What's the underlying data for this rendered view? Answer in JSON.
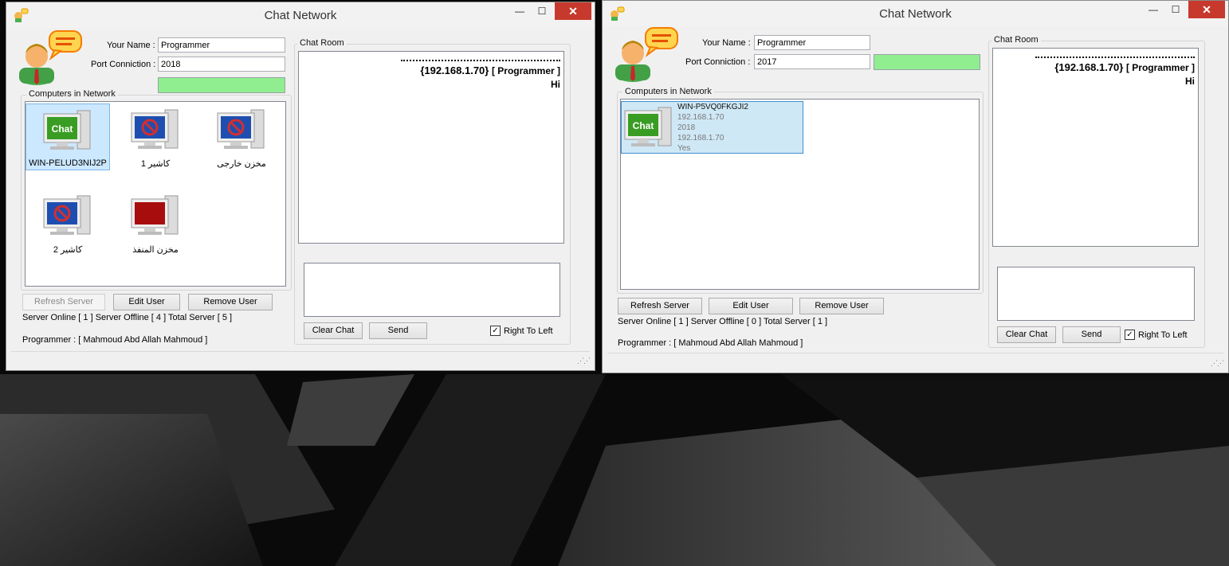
{
  "left_window": {
    "title": "Chat Network",
    "your_name_label": "Your Name :",
    "your_name_value": "Programmer",
    "port_label": "Port Conniction :",
    "port_value": "2018",
    "status_color": "#90ee90",
    "computers_label": "Computers in Network",
    "computers": [
      {
        "name": "WIN-PELUD3NIJ2P",
        "icon": "chat-monitor-icon",
        "selected": true
      },
      {
        "name": "كاشير 1",
        "icon": "blocked-monitor-icon",
        "selected": false
      },
      {
        "name": "مخزن خارجى",
        "icon": "blocked-monitor-icon",
        "selected": false
      },
      {
        "name": "كاشير 2",
        "icon": "blocked-monitor-icon",
        "selected": false
      },
      {
        "name": "مخزن المنفذ",
        "icon": "red-monitor-icon",
        "selected": false
      }
    ],
    "refresh_label": "Refresh Server",
    "edit_label": "Edit User",
    "remove_label": "Remove User",
    "server_status": "Server Online [ 1 ]  Server Offline [ 4 ] Total Server [ 5 ]",
    "programmer": "Programmer : [ Mahmoud Abd Allah Mahmoud ]",
    "chat_room_label": "Chat Room",
    "chat_ip": "{192.168.1.70}",
    "chat_user": "[ Programmer ]",
    "chat_message": "Hi",
    "clear_label": "Clear Chat",
    "send_label": "Send",
    "rtl_label": "Right To Left",
    "rtl_checked": "✓"
  },
  "right_window": {
    "title": "Chat Network",
    "your_name_label": "Your Name :",
    "your_name_value": "Programmer",
    "port_label": "Port Conniction :",
    "port_value": "2017",
    "status_color": "#90ee90",
    "computers_label": "Computers in Network",
    "tile": {
      "name": "WIN-P5VQ0FKGJI2",
      "ip": "192.168.1.70",
      "port": "2018",
      "ip2": "192.168.1.70",
      "online": "Yes",
      "icon": "chat-monitor-icon"
    },
    "refresh_label": "Refresh Server",
    "edit_label": "Edit User",
    "remove_label": "Remove User",
    "server_status": "Server Online [ 1 ]  Server Offline [ 0 ] Total Server [ 1 ]",
    "programmer": "Programmer : [ Mahmoud Abd Allah Mahmoud ]",
    "chat_room_label": "Chat Room",
    "chat_ip": "{192.168.1.70}",
    "chat_user": "[ Programmer ]",
    "chat_message": "Hi",
    "clear_label": "Clear Chat",
    "send_label": "Send",
    "rtl_label": "Right To Left",
    "rtl_checked": "✓"
  }
}
